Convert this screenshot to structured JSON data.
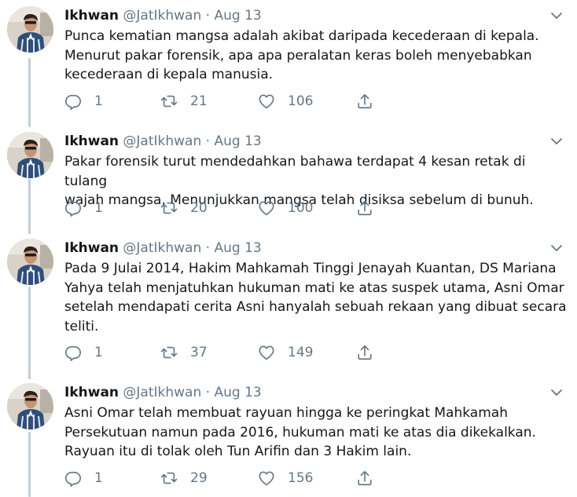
{
  "colors": {
    "text": "#14171a",
    "muted": "#657786",
    "thread_line": "#c4cfd6"
  },
  "icons": [
    "reply-icon",
    "retweet-icon",
    "like-icon",
    "share-icon",
    "chevron-down-icon"
  ],
  "tweets": [
    {
      "author_name": "Ikhwan",
      "handle": "@JatIkhwan",
      "separator": "·",
      "date": "Aug 13",
      "lines": [
        "Punca kematian mangsa adalah akibat daripada kecederaan di kepala.",
        "Menurut pakar forensik, apa apa peralatan keras boleh menyebabkan",
        "kecederaan di kepala manusia."
      ],
      "replies": "1",
      "retweets": "21",
      "likes": "106"
    },
    {
      "author_name": "Ikhwan",
      "handle": "@JatIkhwan",
      "separator": "·",
      "date": "Aug 13",
      "lines": [
        "Pakar forensik turut mendedahkan bahawa terdapat 4 kesan retak di tulang",
        "wajah mangsa. Menunjukkan mangsa telah disiksa sebelum di bunuh."
      ],
      "replies": "1",
      "retweets": "20",
      "likes": "100"
    },
    {
      "author_name": "Ikhwan",
      "handle": "@JatIkhwan",
      "separator": "·",
      "date": "Aug 13",
      "lines": [
        "Pada 9 Julai 2014, Hakim Mahkamah Tinggi Jenayah Kuantan, DS Mariana",
        "Yahya telah menjatuhkan hukuman mati ke atas suspek utama, Asni Omar",
        "setelah mendapati cerita Asni hanyalah sebuah rekaan yang dibuat secara",
        "teliti."
      ],
      "replies": "1",
      "retweets": "37",
      "likes": "149"
    },
    {
      "author_name": "Ikhwan",
      "handle": "@JatIkhwan",
      "separator": "·",
      "date": "Aug 13",
      "lines": [
        "Asni Omar telah membuat rayuan hingga ke peringkat Mahkamah",
        "Persekutuan namun pada 2016, hukuman mati ke atas dia dikekalkan.",
        "Rayuan itu di tolak oleh Tun Arifin dan 3 Hakim lain."
      ],
      "replies": "1",
      "retweets": "29",
      "likes": "156"
    }
  ]
}
